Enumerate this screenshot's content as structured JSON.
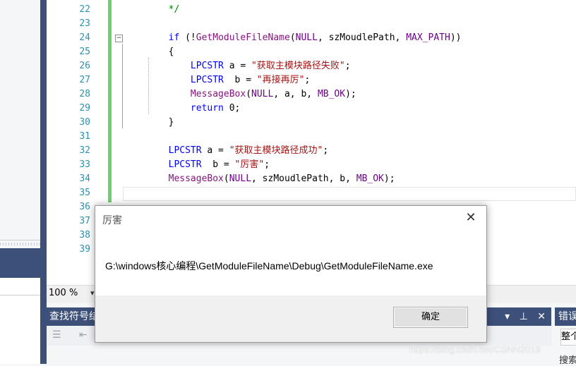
{
  "editor": {
    "lines": [
      {
        "no": "22",
        "parts": [
          {
            "c": "cm",
            "t": "        */"
          }
        ]
      },
      {
        "no": "23",
        "parts": []
      },
      {
        "no": "24",
        "parts": [
          {
            "c": "kw",
            "t": "        if"
          },
          {
            "c": "pl",
            "t": " (!"
          },
          {
            "c": "fn",
            "t": "GetModuleFileName"
          },
          {
            "c": "pl",
            "t": "("
          },
          {
            "c": "mac",
            "t": "NULL"
          },
          {
            "c": "pl",
            "t": ", szMoudlePath, "
          },
          {
            "c": "mac",
            "t": "MAX_PATH"
          },
          {
            "c": "pl",
            "t": "))"
          }
        ]
      },
      {
        "no": "25",
        "parts": [
          {
            "c": "pl",
            "t": "        {"
          }
        ]
      },
      {
        "no": "26",
        "parts": [
          {
            "c": "ty",
            "t": "            LPCSTR"
          },
          {
            "c": "pl",
            "t": " a = "
          },
          {
            "c": "str",
            "t": "\"获取主模块路径失败\""
          },
          {
            "c": "pl",
            "t": ";"
          }
        ]
      },
      {
        "no": "27",
        "parts": [
          {
            "c": "ty",
            "t": "            LPCSTR"
          },
          {
            "c": "pl",
            "t": "  b = "
          },
          {
            "c": "str",
            "t": "\"再接再厉\""
          },
          {
            "c": "pl",
            "t": ";"
          }
        ]
      },
      {
        "no": "28",
        "parts": [
          {
            "c": "fn",
            "t": "            MessageBox"
          },
          {
            "c": "pl",
            "t": "("
          },
          {
            "c": "mac",
            "t": "NULL"
          },
          {
            "c": "pl",
            "t": ", a, b, "
          },
          {
            "c": "mac",
            "t": "MB_OK"
          },
          {
            "c": "pl",
            "t": ");"
          }
        ]
      },
      {
        "no": "29",
        "parts": [
          {
            "c": "kw",
            "t": "            return"
          },
          {
            "c": "pl",
            "t": " 0;"
          }
        ]
      },
      {
        "no": "30",
        "parts": [
          {
            "c": "pl",
            "t": "        }"
          }
        ]
      },
      {
        "no": "31",
        "parts": []
      },
      {
        "no": "32",
        "parts": [
          {
            "c": "ty",
            "t": "        LPCSTR"
          },
          {
            "c": "pl",
            "t": " a = "
          },
          {
            "c": "str",
            "t": "\"获取主模块路径成功\""
          },
          {
            "c": "pl",
            "t": ";"
          }
        ]
      },
      {
        "no": "33",
        "parts": [
          {
            "c": "ty",
            "t": "        LPCSTR"
          },
          {
            "c": "pl",
            "t": "  b = "
          },
          {
            "c": "str",
            "t": "\"厉害\""
          },
          {
            "c": "pl",
            "t": ";"
          }
        ]
      },
      {
        "no": "34",
        "parts": [
          {
            "c": "fn",
            "t": "        MessageBox"
          },
          {
            "c": "pl",
            "t": "("
          },
          {
            "c": "mac",
            "t": "NULL"
          },
          {
            "c": "pl",
            "t": ", szMoudlePath, b, "
          },
          {
            "c": "mac",
            "t": "MB_OK"
          },
          {
            "c": "pl",
            "t": ");"
          }
        ]
      },
      {
        "no": "35",
        "parts": []
      },
      {
        "no": "36",
        "parts": []
      },
      {
        "no": "37",
        "parts": []
      },
      {
        "no": "38",
        "parts": []
      },
      {
        "no": "39",
        "parts": []
      }
    ]
  },
  "zoom": {
    "value": "100 %",
    "arrow": "▾"
  },
  "find_panel": {
    "title": "查找符号结果",
    "buttons": [
      "▾",
      "⊥",
      "✕"
    ]
  },
  "error_panel": {
    "title": "错误列表",
    "filter": "整个解决方案",
    "search": "搜索"
  },
  "dialog": {
    "title": "厉害",
    "message": "G:\\windows核心编程\\GetModuleFileName\\Debug\\GetModuleFileName.exe",
    "ok_label": "确定",
    "close": "✕"
  },
  "watermark": "https://blog.csdn.net/CSNN2019"
}
